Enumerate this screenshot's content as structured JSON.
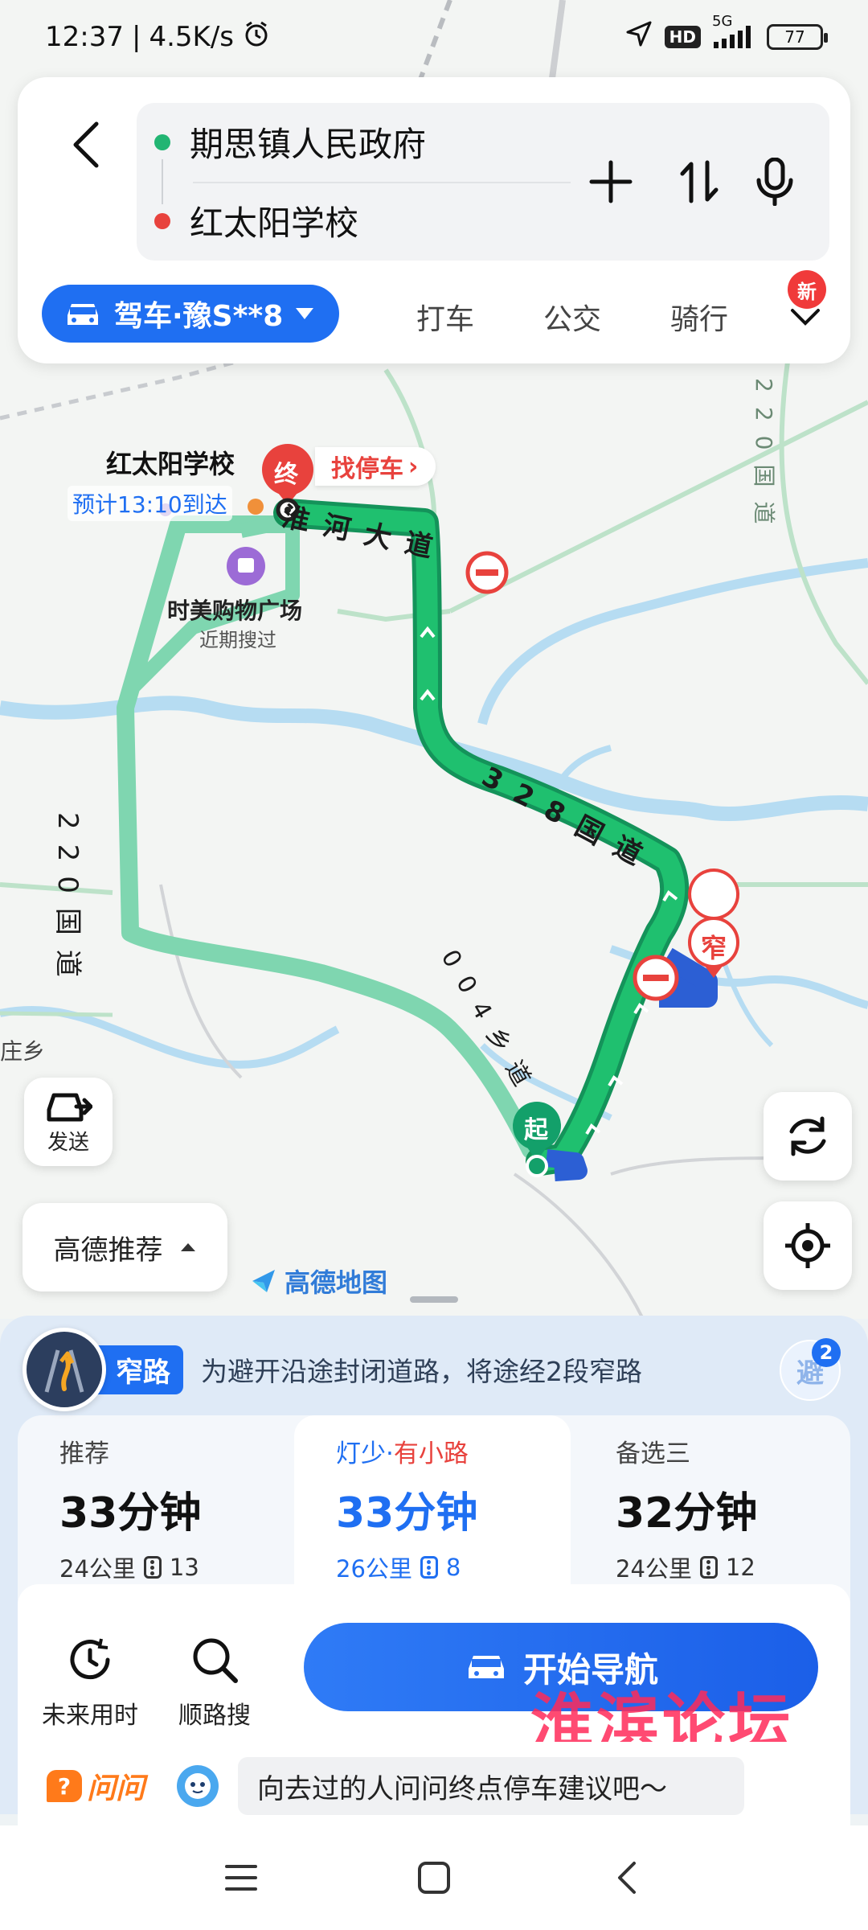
{
  "status_bar": {
    "time": "12:37",
    "speed": "4.5K/s",
    "network": "5G",
    "hd": "HD",
    "battery": "77"
  },
  "search": {
    "origin": "期思镇人民政府",
    "destination": "红太阳学校",
    "origin_color": "#22b573",
    "destination_color": "#e8423d"
  },
  "modes": {
    "drive": "驾车·豫S**8",
    "tabs": [
      "打车",
      "公交",
      "骑行"
    ],
    "new_badge": "新"
  },
  "map": {
    "dest_name": "红太阳学校",
    "eta": "预计13:10到达",
    "end_marker": "终",
    "start_marker": "起",
    "narrow_marker": "窄",
    "parking": "找停车",
    "mall": "时美购物广场",
    "mall_sub": "近期搜过",
    "roads": {
      "r1": "淮河大道",
      "r2": "328国道",
      "r3": "220国道",
      "r4": "004乡道",
      "r5": "220国道"
    },
    "town": "庄乡",
    "share": "发送",
    "preference": "高德推荐",
    "logo": "高德地图",
    "route_color": "#1bb86a",
    "alt_route_color": "#7fd6b0"
  },
  "notice": {
    "tag": "窄路",
    "text": "为避开沿途封闭道路，将途经2段窄路",
    "avoid": "避",
    "avoid_count": "2"
  },
  "routes": [
    {
      "label": "推荐",
      "highlight": "",
      "time": "33分钟",
      "distance": "24公里",
      "lights": "13"
    },
    {
      "label": "灯少·",
      "highlight": "有小路",
      "time": "33分钟",
      "distance": "26公里",
      "lights": "8"
    },
    {
      "label": "备选三",
      "highlight": "",
      "time": "32分钟",
      "distance": "24公里",
      "lights": "12"
    }
  ],
  "actions": {
    "future": "未来用时",
    "along": "顺路搜",
    "start": "开始导航"
  },
  "ask": {
    "brand": "问问",
    "prompt": "向去过的人问问终点停车建议吧～"
  },
  "watermark": "淮滨论坛"
}
